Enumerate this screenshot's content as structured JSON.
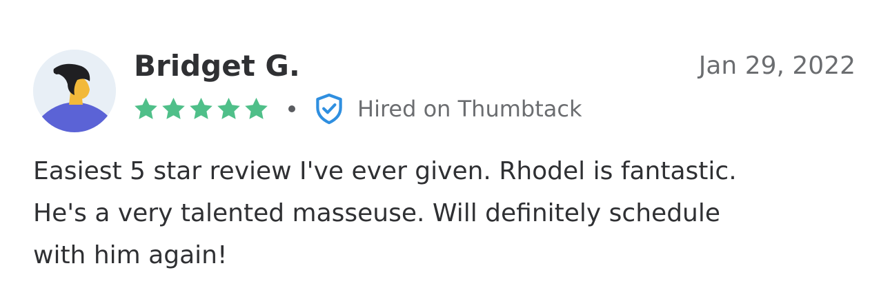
{
  "review": {
    "reviewer_name": "Bridget G.",
    "date": "Jan 29, 2022",
    "rating": 5,
    "rating_max": 5,
    "hired_badge": "Hired on Thumbtack",
    "text_lines": [
      "Easiest 5 star review I've ever given. Rhodel is fantastic.",
      "He's a very talented masseuse. Will definitely schedule",
      "with him again!"
    ]
  },
  "icons": {
    "avatar": "person-avatar-icon",
    "star": "star-icon",
    "badge": "shield-check-icon"
  },
  "colors": {
    "star": "#4fbf89",
    "shield": "#2f8fe0",
    "avatar_shirt": "#5b63d6",
    "avatar_bg": "#e8eff6"
  }
}
